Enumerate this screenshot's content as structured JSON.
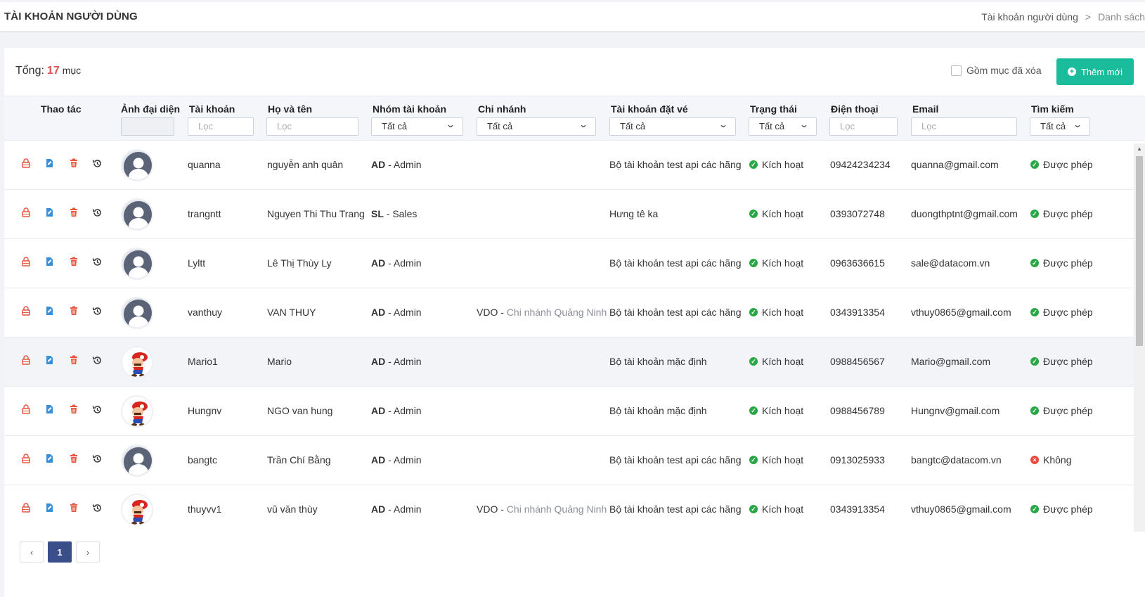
{
  "header": {
    "title": "TÀI KHOẢN NGƯỜI DÙNG",
    "breadcrumb": [
      "Tài khoản người dùng",
      "Danh sách"
    ],
    "breadcrumb_separator": ">"
  },
  "toolbar": {
    "total_label": "Tổng:",
    "total_count": "17",
    "total_unit": "mục",
    "include_deleted_label": "Gồm mục đã xóa",
    "include_deleted_checked": false,
    "add_button_label": "Thêm mới",
    "add_button_color": "#1abc9c"
  },
  "columns": {
    "actions": "Thao tác",
    "avatar": "Ảnh đại diện",
    "account": "Tài khoản",
    "fullname": "Họ và tên",
    "group": "Nhóm tài khoản",
    "branch": "Chi nhánh",
    "booking_account": "Tài khoản đặt vé",
    "status": "Trạng thái",
    "phone": "Điện thoại",
    "email": "Email",
    "search": "Tìm kiếm"
  },
  "filters": {
    "input_placeholder": "Lọc",
    "select_all": "Tất cả"
  },
  "action_icons": [
    "lock-icon",
    "edit-icon",
    "delete-icon",
    "history-icon"
  ],
  "rows": [
    {
      "account": "quanna",
      "fullname": "nguyễn anh quân",
      "group_code": "AD",
      "group_name": "Admin",
      "branch_code": "",
      "branch_name": "",
      "booking_account": "Bộ tài khoản test api các hãng",
      "status": "Kích hoạt",
      "phone": "09424234234",
      "email": "quanna@gmail.com",
      "search": "Được phép",
      "search_allowed": true,
      "avatar": "default"
    },
    {
      "account": "trangntt",
      "fullname": "Nguyen Thi Thu Trang",
      "group_code": "SL",
      "group_name": "Sales",
      "branch_code": "",
      "branch_name": "",
      "booking_account": "Hưng tê ka",
      "status": "Kích hoạt",
      "phone": "0393072748",
      "email": "duongthptnt@gmail.com",
      "search": "Được phép",
      "search_allowed": true,
      "avatar": "default"
    },
    {
      "account": "Lyltt",
      "fullname": "Lê Thị Thùy Ly",
      "group_code": "AD",
      "group_name": "Admin",
      "branch_code": "",
      "branch_name": "",
      "booking_account": "Bộ tài khoản test api các hãng",
      "status": "Kích hoạt",
      "phone": "0963636615",
      "email": "sale@datacom.vn",
      "search": "Được phép",
      "search_allowed": true,
      "avatar": "default"
    },
    {
      "account": "vanthuy",
      "fullname": "VAN THUY",
      "group_code": "AD",
      "group_name": "Admin",
      "branch_code": "VDO",
      "branch_name": "Chi nhánh Quảng Ninh",
      "booking_account": "Bộ tài khoản test api các hãng",
      "status": "Kích hoạt",
      "phone": "0343913354",
      "email": "vthuy0865@gmail.com",
      "search": "Được phép",
      "search_allowed": true,
      "avatar": "default"
    },
    {
      "account": "Mario1",
      "fullname": "Mario",
      "group_code": "AD",
      "group_name": "Admin",
      "branch_code": "",
      "branch_name": "",
      "booking_account": "Bộ tài khoản mặc định",
      "status": "Kích hoạt",
      "phone": "0988456567",
      "email": "Mario@gmail.com",
      "search": "Được phép",
      "search_allowed": true,
      "avatar": "mario"
    },
    {
      "account": "Hungnv",
      "fullname": "NGO van hung",
      "group_code": "AD",
      "group_name": "Admin",
      "branch_code": "",
      "branch_name": "",
      "booking_account": "Bộ tài khoản mặc định",
      "status": "Kích hoạt",
      "phone": "0988456789",
      "email": "Hungnv@gmail.com",
      "search": "Được phép",
      "search_allowed": true,
      "avatar": "mario"
    },
    {
      "account": "bangtc",
      "fullname": "Trần Chí Bằng",
      "group_code": "AD",
      "group_name": "Admin",
      "branch_code": "",
      "branch_name": "",
      "booking_account": "Bộ tài khoản test api các hãng",
      "status": "Kích hoạt",
      "phone": "0913025933",
      "email": "bangtc@datacom.vn",
      "search": "Không",
      "search_allowed": false,
      "avatar": "default"
    },
    {
      "account": "thuyvv1",
      "fullname": "vũ văn thùy",
      "group_code": "AD",
      "group_name": "Admin",
      "branch_code": "VDO",
      "branch_name": "Chi nhánh Quảng Ninh",
      "booking_account": "Bộ tài khoản test api các hãng",
      "status": "Kích hoạt",
      "phone": "0343913354",
      "email": "vthuy0865@gmail.com",
      "search": "Được phép",
      "search_allowed": true,
      "avatar": "mario"
    }
  ],
  "pagination": {
    "prev": "‹",
    "pages": [
      "1"
    ],
    "current": "1",
    "next": "›"
  },
  "colors": {
    "accent": "#1abc9c",
    "count": "#d9534f",
    "active_page": "#3b4e8c",
    "status_ok": "#28a745",
    "status_no": "#e74c3c",
    "lock_icon": "#e8563f",
    "edit_icon": "#3a8fd9",
    "delete_icon": "#e8563f"
  }
}
